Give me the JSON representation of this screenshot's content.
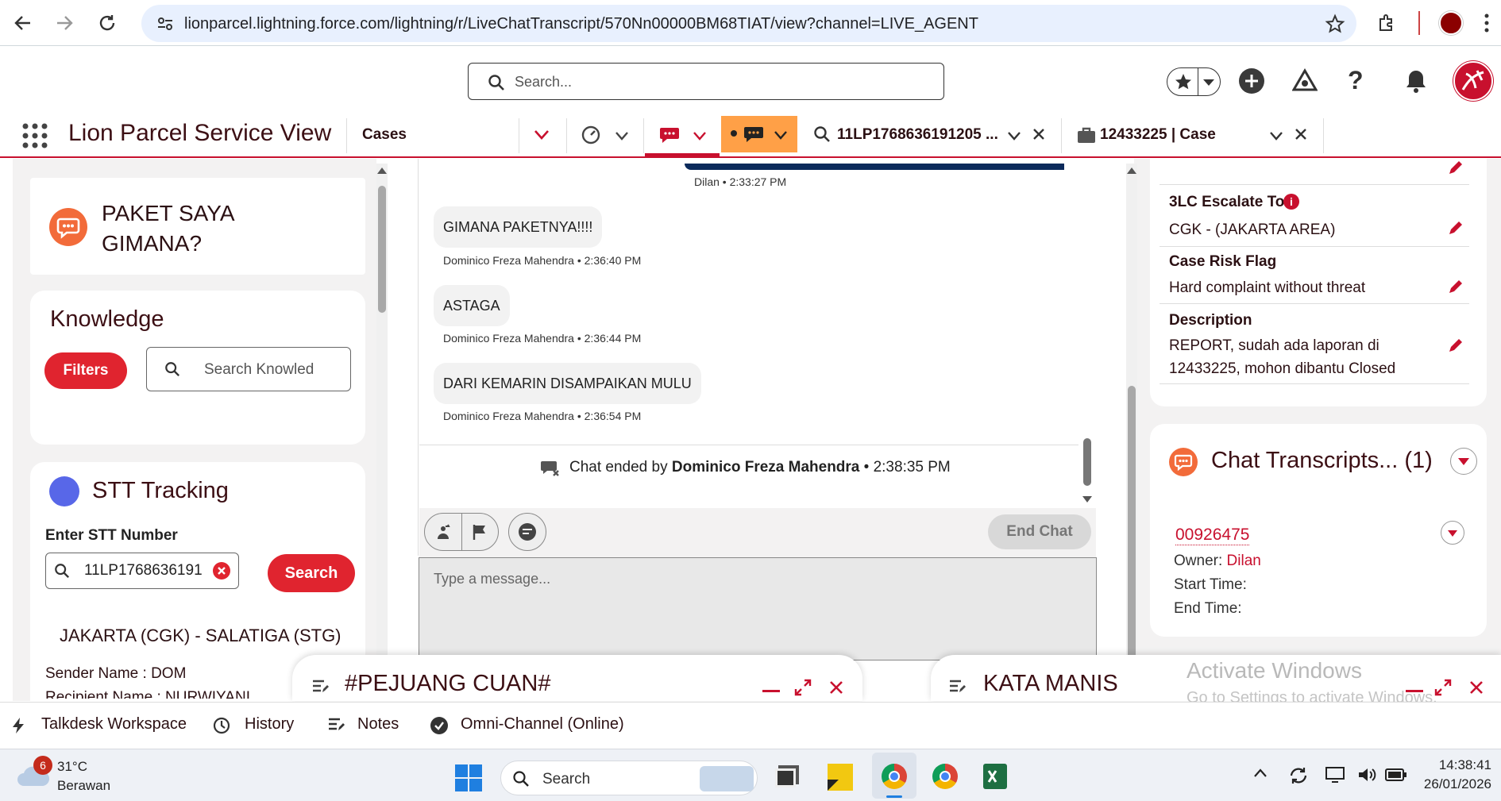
{
  "browser": {
    "url": "lionparcel.lightning.force.com/lightning/r/LiveChatTranscript/570Nn00000BM68TIAT/view?channel=LIVE_AGENT"
  },
  "header": {
    "search_placeholder": "Search..."
  },
  "nav": {
    "app_name": "Lion Parcel Service View",
    "object_tab": "Cases",
    "tabs": [
      {
        "label": "11LP1768636191205 ..."
      },
      {
        "label": "12433225 | Case"
      }
    ]
  },
  "left": {
    "chat_title": "PAKET SAYA GIMANA?",
    "knowledge": {
      "title": "Knowledge",
      "filters_label": "Filters",
      "search_placeholder": "Search Knowled"
    },
    "stt": {
      "title": "STT Tracking",
      "input_label": "Enter STT Number",
      "input_value": "11LP1768636191",
      "search_label": "Search",
      "route": "JAKARTA (CGK) - SALATIGA (STG)",
      "sender": "Sender Name : DOM",
      "recipient": "Recipient Name : NURWIYANI"
    }
  },
  "chat": {
    "prev_meta": "Dilan • 2:33:27 PM",
    "messages": [
      {
        "text": "GIMANA PAKETNYA!!!!",
        "meta": "Dominico Freza Mahendra • 2:36:40 PM"
      },
      {
        "text": "ASTAGA",
        "meta": "Dominico Freza Mahendra • 2:36:44 PM"
      },
      {
        "text": "DARI KEMARIN DISAMPAIKAN MULU",
        "meta": "Dominico Freza Mahendra • 2:36:54 PM"
      }
    ],
    "ended_prefix": "Chat ended by",
    "ended_by": "Dominico Freza Mahendra",
    "ended_time": "• 2:38:35 PM",
    "end_chat_label": "End Chat",
    "message_placeholder": "Type a message..."
  },
  "right": {
    "fields": [
      {
        "label": "3LC Escalate To",
        "value": "CGK - (JAKARTA AREA)"
      },
      {
        "label": "Case Risk Flag",
        "value": "Hard complaint without threat"
      },
      {
        "label": "Description",
        "value": "REPORT, sudah ada laporan di 12433225, mohon dibantu Closed"
      }
    ],
    "transcripts": {
      "title": "Chat Transcripts... (1)",
      "record_id": "00926475",
      "owner_label": "Owner:",
      "owner_value": "Dilan",
      "start_label": "Start Time:",
      "end_label": "End Time:"
    }
  },
  "docked": {
    "left_title": "#PEJUANG CUAN#",
    "right_title": "KATA MANIS"
  },
  "watermark": {
    "line1": "Activate Windows",
    "line2": "Go to Settings to activate Windows."
  },
  "utility": {
    "items": [
      "Talkdesk Workspace",
      "History",
      "Notes",
      "Omni-Channel (Online)"
    ]
  },
  "taskbar": {
    "weather_badge": "6",
    "temperature": "31°C",
    "condition": "Berawan",
    "search_label": "Search",
    "time": "14:38:41",
    "date": "26/01/2026"
  },
  "colors": {
    "brand_red": "#c8102e",
    "chat_orange": "#f26b3a",
    "active_tab": "#ffa047",
    "stt_dot": "#5867e8"
  }
}
